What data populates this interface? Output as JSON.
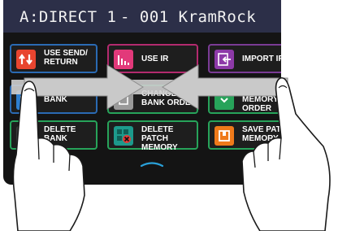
{
  "header": {
    "patch_id": "A:DIRECT 1",
    "patch_name": "- 001 KramRock"
  },
  "tiles": [
    {
      "label": "USE SEND/\nRETURN",
      "icon": "send-return-arrows-icon",
      "icon_color": "#e8452f",
      "border": "#2a6ab3"
    },
    {
      "label": "USE IR",
      "icon": "ir-bars-icon",
      "icon_color": "#e2397a",
      "border": "#b32a6e"
    },
    {
      "label": "IMPORT IR",
      "icon": "import-ir-icon",
      "icon_color": "#8d3aa8",
      "border": "#7a3b95"
    },
    {
      "label": "BANK",
      "icon": "bank-icon",
      "icon_color": "#2e7fd0",
      "border": "#2a6ab3"
    },
    {
      "label": "CHANGE\nBANK ORDER",
      "icon": "bank-order-icon",
      "icon_color": "#9a9a9a",
      "border": "#27a35a"
    },
    {
      "label": "MEMORY ORDER",
      "icon": "memory-order-icon",
      "icon_color": "#27a35a",
      "border": "#27a35a"
    },
    {
      "label": "DELETE\nBANK",
      "icon": "delete-bank-icon",
      "icon_color": "#3a3a3a",
      "border": "#27a35a"
    },
    {
      "label": "DELETE PATCH\nMEMORY",
      "icon": "delete-patch-memory-icon",
      "icon_color": "#1d9a8c",
      "border": "#27a35a"
    },
    {
      "label": "SAVE PATCH\nMEMORY",
      "icon": "save-patch-memory-icon",
      "icon_color": "#ef7a1a",
      "border": "#27a35a"
    }
  ],
  "gesture": {
    "type": "pinch-in",
    "arrow_color": "#c9c9c9"
  },
  "colors": {
    "titlebar": "#2c2f48",
    "screen": "#141414",
    "accent_blue": "#2aa0d8"
  }
}
